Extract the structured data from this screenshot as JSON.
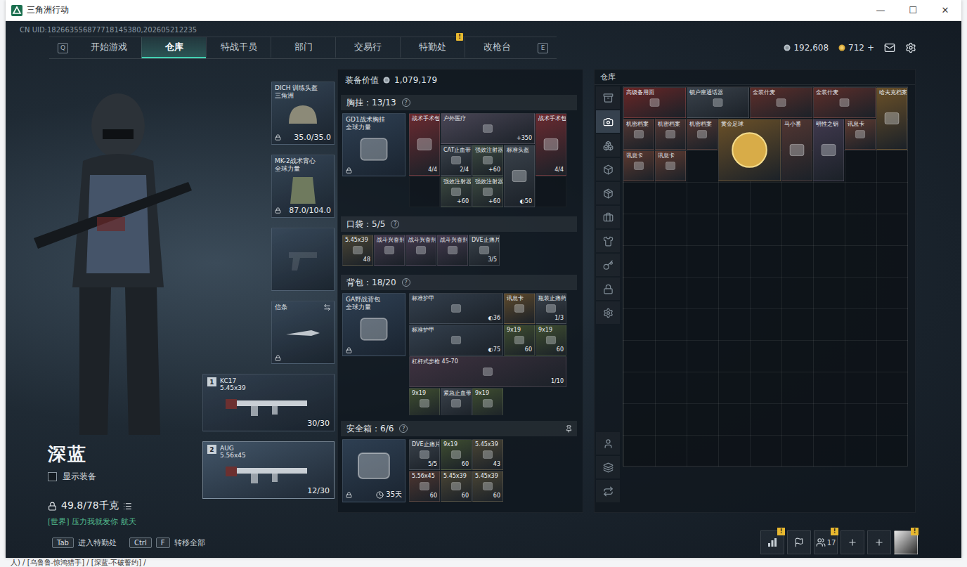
{
  "window": {
    "title": "三角洲行动",
    "controls": [
      "—",
      "☐",
      "✕"
    ]
  },
  "uid": "CN UID:182663556877718145380,202605212235",
  "nav": {
    "prev_key": "Q",
    "next_key": "E",
    "tabs": [
      {
        "label": "开始游戏",
        "selected": false,
        "badge": ""
      },
      {
        "label": "仓库",
        "selected": true,
        "badge": ""
      },
      {
        "label": "特战干员",
        "selected": false,
        "badge": ""
      },
      {
        "label": "部门",
        "selected": false,
        "badge": ""
      },
      {
        "label": "交易行",
        "selected": false,
        "badge": ""
      },
      {
        "label": "特勤处",
        "selected": false,
        "badge": "!"
      },
      {
        "label": "改枪台",
        "selected": false,
        "badge": ""
      }
    ]
  },
  "currency": {
    "coins": "192,608",
    "tickets": "712",
    "add": "+"
  },
  "character": {
    "name": "深蓝",
    "show_gear": {
      "label": "显示装备",
      "checked": false
    },
    "weight": "49.8/78千克",
    "chat": "[世界] 压力我就发你 航天"
  },
  "gear_slots": [
    {
      "kind": "helmet",
      "name": "DICH 训练头盔",
      "sub": "三角洲",
      "value": "35.0/35.0"
    },
    {
      "kind": "armor",
      "name": "MK-2战术背心",
      "sub": "全球力量",
      "value": "87.0/104.0"
    },
    {
      "kind": "pistol",
      "name": "",
      "sub": "",
      "value": ""
    },
    {
      "kind": "knife",
      "name": "信条",
      "sub": "",
      "value": ""
    }
  ],
  "weapons": [
    {
      "slot": "1",
      "name": "KC17",
      "caliber": "5.45x39",
      "ammo": "30/30",
      "selected": false
    },
    {
      "slot": "2",
      "name": "AUG",
      "caliber": "5.56x45",
      "ammo": "12/30",
      "selected": true
    }
  ],
  "loadout": {
    "value_label": "装备价值",
    "value": "1,079,179",
    "sections": [
      {
        "kind": "chest",
        "title": "胸挂：13/13",
        "help": "?",
        "pinned": false,
        "container": {
          "name": "GD1战术胸挂",
          "sub": "全球力量",
          "value": ""
        },
        "items": [
          {
            "name": "战术手术包",
            "value": "4/4",
            "kind": "tall",
            "color": "#6a2a30"
          },
          {
            "name": "户外医疗",
            "value": "+350",
            "kind": "wide3",
            "color": "#4a4656"
          },
          {
            "name": "战术手术包",
            "value": "4/4",
            "kind": "tall",
            "color": "#6a2a30"
          },
          {
            "name": "CAT止血带",
            "value": "2/4",
            "kind": "single",
            "color": "#3a424b"
          },
          {
            "name": "强效注射器",
            "value": "+60",
            "kind": "single",
            "color": "#3c4a40"
          },
          {
            "name": "标准头盔",
            "value": "◐50",
            "kind": "tall",
            "color": "#3a424b"
          },
          {
            "name": "",
            "value": "",
            "kind": "empty",
            "color": "#000000"
          },
          {
            "name": "强效注射器",
            "value": "+60",
            "kind": "single",
            "color": "#3c4a40"
          },
          {
            "name": "强效注射器",
            "value": "+60",
            "kind": "single",
            "color": "#3c4a40"
          },
          {
            "name": "",
            "value": "",
            "kind": "empty",
            "color": "#000000"
          }
        ]
      },
      {
        "kind": "pocket",
        "title": "口袋：5/5",
        "help": "?",
        "pinned": false,
        "container": null,
        "items": [
          {
            "name": "5.45x39",
            "value": "48",
            "kind": "single",
            "color": "#4a4534"
          },
          {
            "name": "战斗兴奋剂",
            "value": "",
            "kind": "single",
            "color": "#43394d"
          },
          {
            "name": "战斗兴奋剂",
            "value": "",
            "kind": "single",
            "color": "#43394d"
          },
          {
            "name": "战斗兴奋剂",
            "value": "",
            "kind": "single",
            "color": "#43394d"
          },
          {
            "name": "DVE止痛片",
            "value": "3/5",
            "kind": "single",
            "color": "#3a424b"
          }
        ]
      },
      {
        "kind": "backpack",
        "title": "背包：18/20",
        "help": "?",
        "pinned": false,
        "container": {
          "name": "GA野战背包",
          "sub": "全球力量",
          "value": ""
        },
        "items": [
          {
            "name": "标准护甲",
            "value": "◐36",
            "kind": "wide3",
            "color": "#34404e"
          },
          {
            "name": "讯息卡",
            "value": "",
            "kind": "single",
            "color": "#5e4a2c"
          },
          {
            "name": "瓶装止痛药",
            "value": "1/3",
            "kind": "single",
            "color": "#3a424b"
          },
          {
            "name": "标准护甲",
            "value": "◐75",
            "kind": "wide3",
            "color": "#34404e"
          },
          {
            "name": "9x19",
            "value": "60",
            "kind": "single",
            "color": "#3f4e30"
          },
          {
            "name": "9x19",
            "value": "60",
            "kind": "single",
            "color": "#3f4e30"
          },
          {
            "name": "杠杆式步枪 45-70",
            "value": "1/10",
            "kind": "wide5",
            "color": "#3f3240"
          },
          {
            "name": "9x19",
            "value": "",
            "kind": "single",
            "color": "#3f4e30"
          },
          {
            "name": "紧急止血带",
            "value": "",
            "kind": "single",
            "color": "#3a424b"
          },
          {
            "name": "9x19",
            "value": "",
            "kind": "single",
            "color": "#3f4e30"
          }
        ]
      },
      {
        "kind": "safe",
        "title": "安全箱：6/6",
        "help": "?",
        "pinned": true,
        "container": {
          "name": "",
          "sub": "",
          "value": "35天"
        },
        "items": [
          {
            "name": "DVE止痛片",
            "value": "5/5",
            "kind": "single",
            "color": "#3a424b"
          },
          {
            "name": "9x19",
            "value": "60",
            "kind": "single",
            "color": "#3f4e30"
          },
          {
            "name": "5.45x39",
            "value": "43",
            "kind": "single",
            "color": "#4a4534"
          },
          {
            "name": "5.56x45",
            "value": "60",
            "kind": "single",
            "color": "#4e3630"
          },
          {
            "name": "5.45x39",
            "value": "60",
            "kind": "single",
            "color": "#4a4534"
          },
          {
            "name": "5.45x39",
            "value": "60",
            "kind": "single",
            "color": "#4a4534"
          }
        ]
      }
    ]
  },
  "warehouse": {
    "title": "仓库",
    "side_tabs": [
      {
        "selected": false
      },
      {
        "selected": true
      },
      {
        "selected": false
      },
      {
        "selected": false
      },
      {
        "selected": false
      },
      {
        "selected": false
      },
      {
        "selected": false
      },
      {
        "selected": false
      },
      {
        "selected": false
      },
      {
        "selected": false
      },
      {
        "selected": false
      },
      {
        "selected": false
      },
      {
        "selected": false
      }
    ],
    "items": [
      {
        "name": "高级备用面",
        "value": "",
        "kind": "wide",
        "color": "#6a2626"
      },
      {
        "name": "锁户座通话器",
        "value": "",
        "kind": "wide",
        "color": "#3a424b"
      },
      {
        "name": "金装什麦",
        "value": "",
        "kind": "wide",
        "color": "#5e2e2a"
      },
      {
        "name": "金装什麦",
        "value": "",
        "kind": "wide",
        "color": "#5e2e2a"
      },
      {
        "name": "哈夫克档案",
        "value": "",
        "kind": "tall",
        "color": "#6a5028"
      },
      {
        "name": "机密档案",
        "value": "",
        "kind": "single",
        "color": "#523632"
      },
      {
        "name": "机密档案",
        "value": "",
        "kind": "single",
        "color": "#523632"
      },
      {
        "name": "机密档案",
        "value": "",
        "kind": "single",
        "color": "#523632"
      },
      {
        "name": "黄金足球",
        "value": "",
        "kind": "big",
        "color": "#6a5028"
      },
      {
        "name": "马小番",
        "value": "",
        "kind": "tall",
        "color": "#523632"
      },
      {
        "name": "明性之钥",
        "value": "",
        "kind": "tall",
        "color": "#40394e"
      },
      {
        "name": "讯息卡",
        "value": "",
        "kind": "single",
        "color": "#5e3a30"
      },
      {
        "name": "讯息卡",
        "value": "",
        "kind": "single",
        "color": "#5e3a30"
      },
      {
        "name": "讯息卡",
        "value": "",
        "kind": "single",
        "color": "#5e3a30"
      }
    ]
  },
  "bottom_bar": {
    "hints": [
      {
        "keys": [
          "Tab"
        ],
        "label": "进入特勤处"
      },
      {
        "keys": [
          "Ctrl",
          "F"
        ],
        "label": "转移全部"
      }
    ],
    "social": [
      {
        "kind": "stats",
        "badge": "!",
        "count": ""
      },
      {
        "kind": "flag",
        "badge": "",
        "count": ""
      },
      {
        "kind": "friends",
        "badge": "!",
        "count": "17"
      },
      {
        "kind": "add",
        "badge": "",
        "count": ""
      },
      {
        "kind": "add",
        "badge": "",
        "count": ""
      },
      {
        "kind": "avatar",
        "badge": "!",
        "count": ""
      }
    ]
  },
  "footer_text": "人) / [乌鲁鲁-惊鸿猎手] / [深蓝-不破誓约] /"
}
